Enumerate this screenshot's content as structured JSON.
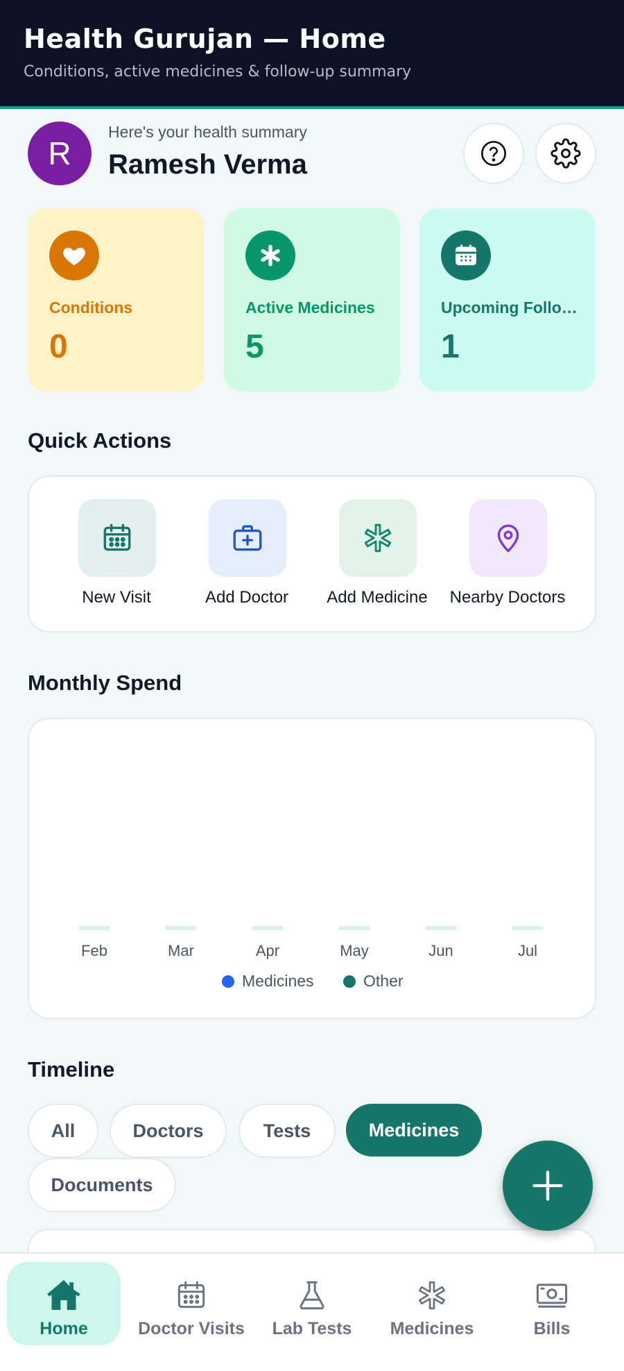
{
  "header": {
    "title": "Health Gurujan — Home",
    "subtitle": "Conditions, active medicines & follow-up summary"
  },
  "user": {
    "initial": "R",
    "greeting": "Here's your health summary",
    "name": "Ramesh Verma",
    "avatar_color": "#7b1fa2"
  },
  "stats": [
    {
      "label": "Conditions",
      "value": "0",
      "icon": "heart-icon",
      "bg": "#fef3c7",
      "accent": "#d97706"
    },
    {
      "label": "Active Medicines",
      "value": "5",
      "icon": "asterisk-icon",
      "bg": "#d1fae5",
      "accent": "#059669"
    },
    {
      "label": "Upcoming Follo…",
      "value": "1",
      "icon": "calendar-icon",
      "bg": "#ccfbf1",
      "accent": "#17766a"
    }
  ],
  "quick_actions": {
    "title": "Quick Actions",
    "items": [
      {
        "label": "New Visit",
        "icon": "calendar-icon"
      },
      {
        "label": "Add Doctor",
        "icon": "medical-bag-icon"
      },
      {
        "label": "Add Medicine",
        "icon": "asterisk-icon"
      },
      {
        "label": "Nearby Doctors",
        "icon": "map-pin-icon"
      }
    ]
  },
  "monthly_spend": {
    "title": "Monthly Spend"
  },
  "chart_data": {
    "type": "bar",
    "categories": [
      "Feb",
      "Mar",
      "Apr",
      "May",
      "Jun",
      "Jul"
    ],
    "series": [
      {
        "name": "Medicines",
        "values": [
          0,
          0,
          0,
          0,
          0,
          0
        ],
        "color": "#2563eb"
      },
      {
        "name": "Other",
        "values": [
          0,
          0,
          0,
          0,
          0,
          0
        ],
        "color": "#17766a"
      }
    ],
    "legend": "bottom",
    "grid": false
  },
  "timeline": {
    "title": "Timeline",
    "chips": [
      "All",
      "Doctors",
      "Tests",
      "Medicines",
      "Documents"
    ],
    "active_chip": "Medicines"
  },
  "bottom_nav": {
    "items": [
      {
        "label": "Home",
        "icon": "home-icon",
        "active": true
      },
      {
        "label": "Doctor Visits",
        "icon": "calendar-icon",
        "active": false
      },
      {
        "label": "Lab Tests",
        "icon": "flask-icon",
        "active": false
      },
      {
        "label": "Medicines",
        "icon": "asterisk-icon",
        "active": false
      },
      {
        "label": "Bills",
        "icon": "banknote-icon",
        "active": false
      }
    ]
  },
  "colors": {
    "brand": "#17766a",
    "header_bg": "#0d1324",
    "page_bg": "#f1f8f7"
  }
}
